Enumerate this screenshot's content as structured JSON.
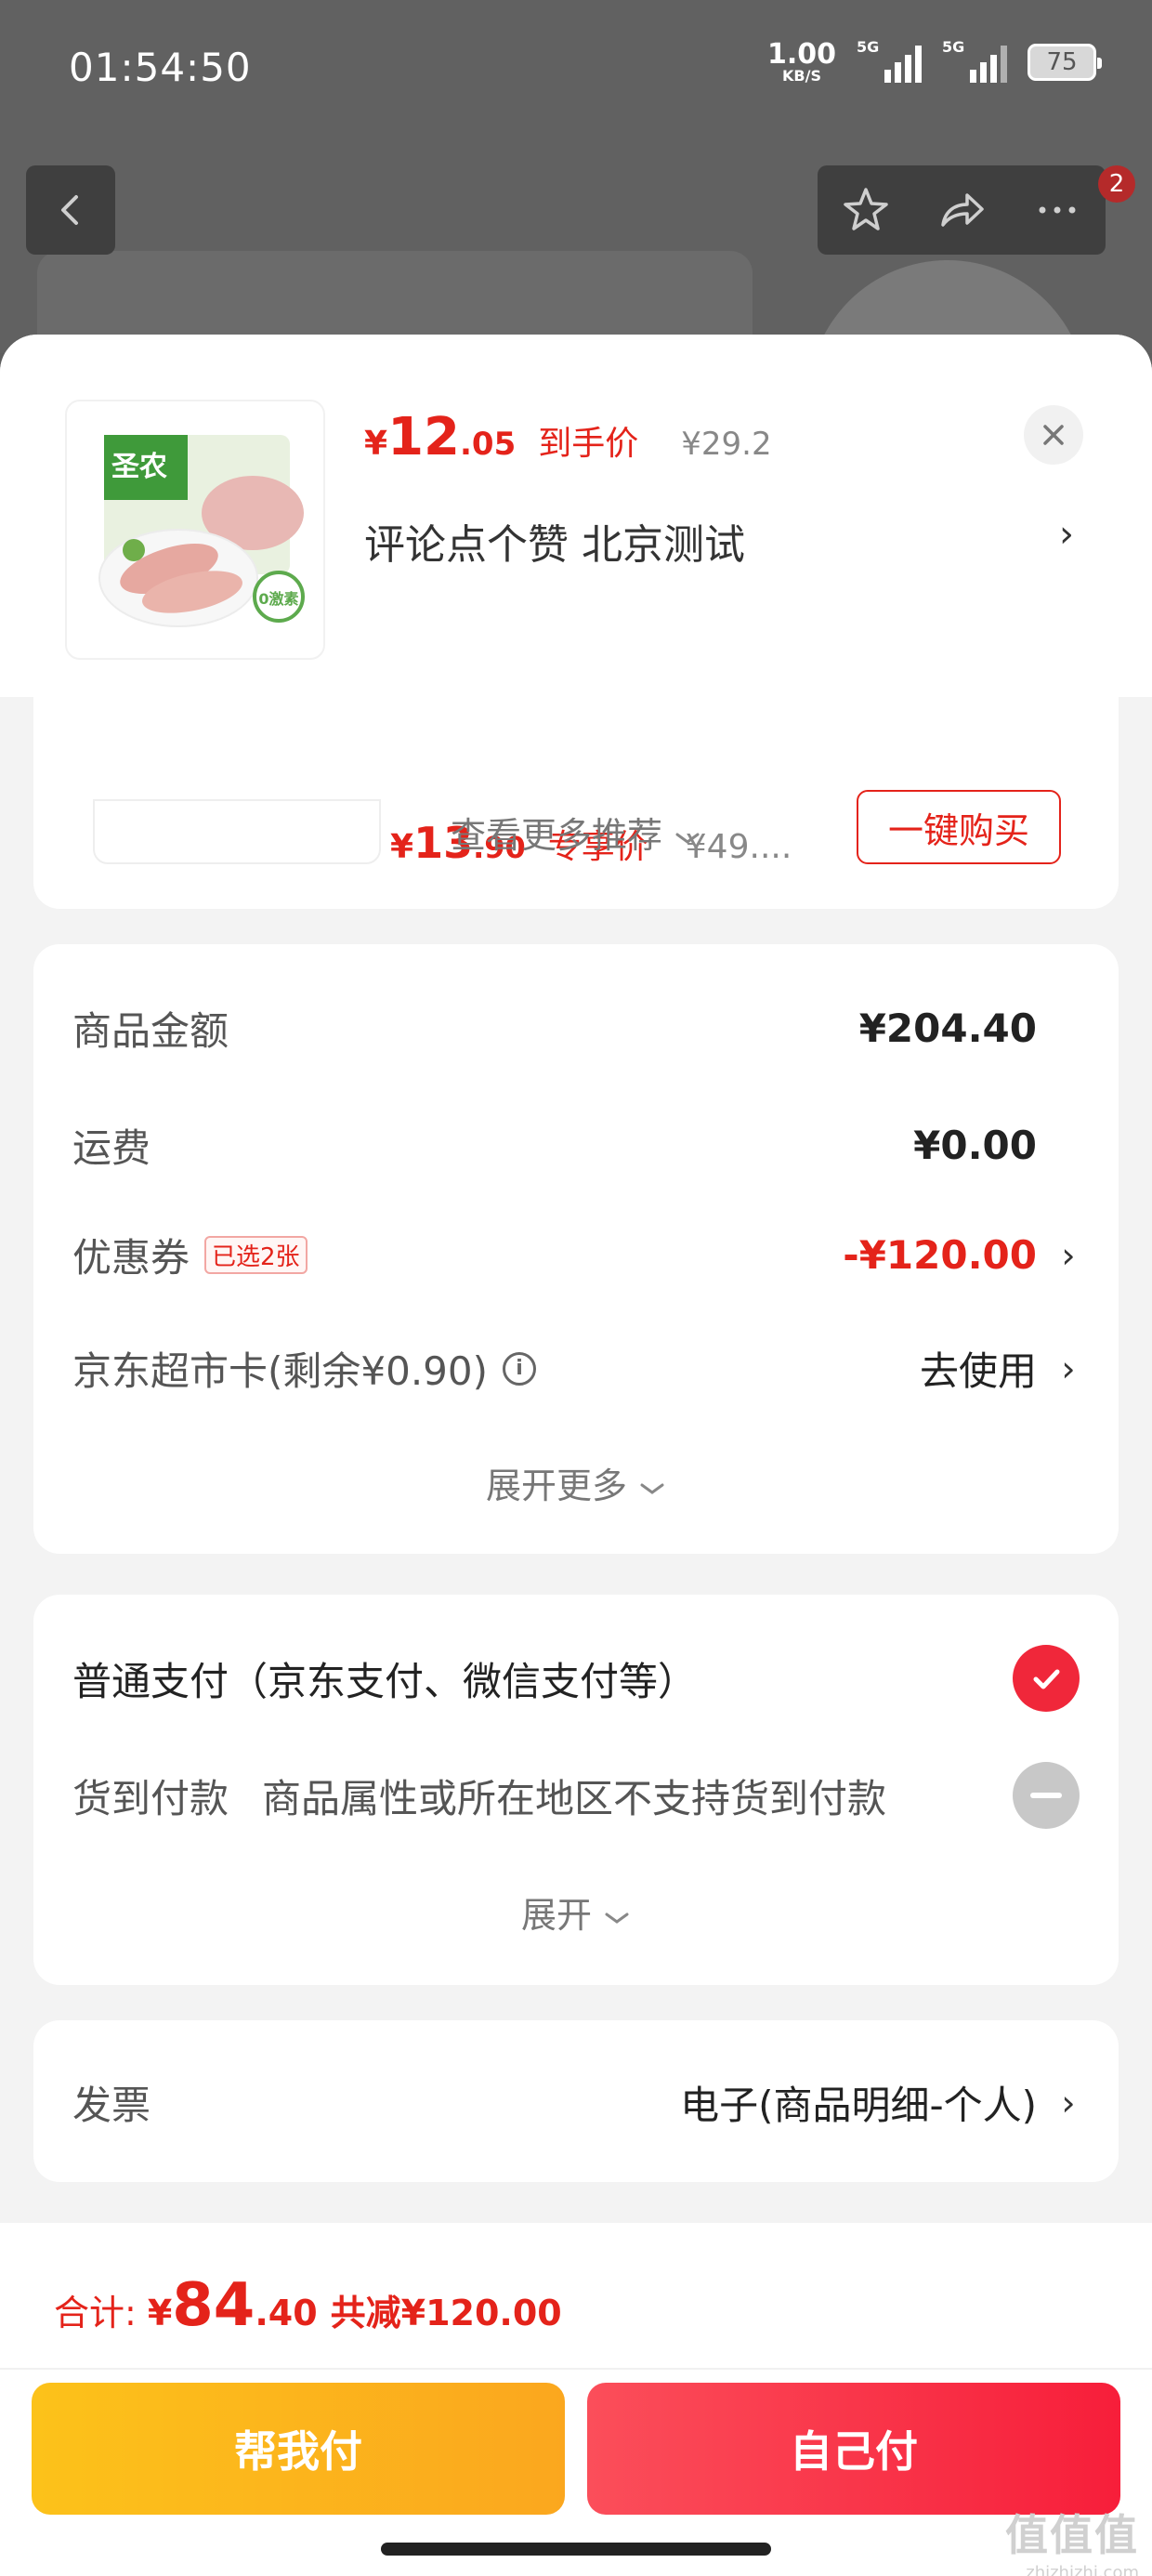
{
  "status_bar": {
    "time": "01:54:50",
    "net_speed_value": "1.00",
    "net_speed_unit": "KB/S",
    "signal_1_label": "5G",
    "signal_2_label": "5G",
    "battery": "75"
  },
  "nav": {
    "badge_count": "2",
    "icons": [
      "back-icon",
      "star-icon",
      "share-icon",
      "more-icon"
    ]
  },
  "sheet": {
    "product": {
      "price_yen": "¥",
      "price_int": "12",
      "price_dec": ".05",
      "price_label": "到手价",
      "original_price": "¥29.2",
      "spec": "评论点个赞  北京测试",
      "spec_arrow": "›",
      "image_brand_text": "圣农",
      "image_badge_text": "0激素"
    },
    "recommend": {
      "price_yen": "¥",
      "price_int": "13",
      "price_dec": ".90",
      "price_label": "专享价",
      "original_price": "¥49....",
      "buy_button": "一键购买",
      "more_label": "查看更多推荐"
    },
    "amounts": {
      "goods_label": "商品金额",
      "goods_value": "¥204.40",
      "shipping_label": "运费",
      "shipping_value": "¥0.00",
      "coupon_label": "优惠券",
      "coupon_tag": "已选2张",
      "coupon_value": "-¥120.00",
      "card_label": "京东超市卡(剩余¥0.90)",
      "card_info": "i",
      "card_value": "去使用",
      "expand_label": "展开更多"
    },
    "payment": {
      "normal_label": "普通支付（京东支付、微信支付等）",
      "cod_label": "货到付款",
      "cod_note": "商品属性或所在地区不支持货到付款",
      "expand_label": "展开"
    },
    "invoice": {
      "label": "发票",
      "value": "电子(商品明细-个人)"
    }
  },
  "bottom": {
    "total_label": "合计:",
    "total_yen": "¥",
    "total_int": "84",
    "total_dec": ".40",
    "total_save": "共减¥120.00",
    "help_pay_button": "帮我付",
    "self_pay_button": "自己付",
    "watermark_main": "值值值",
    "watermark_sub": "zhizhizhi.com"
  },
  "colors": {
    "accent_red": "#e4231a",
    "button_yellow": "#fcc21a",
    "button_red": "#f71e3a",
    "overlay_gray": "#616161"
  }
}
